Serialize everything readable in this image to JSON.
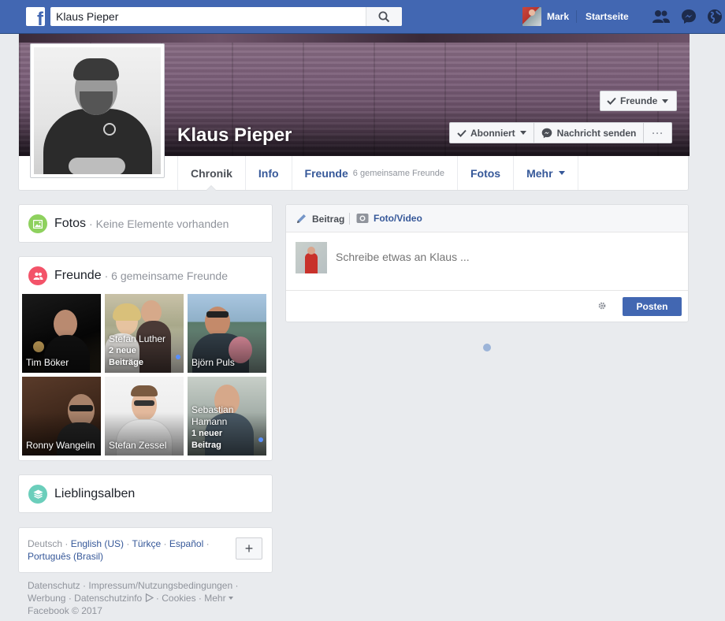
{
  "topbar": {
    "logo_letter": "f",
    "search_value": "Klaus Pieper",
    "user_name": "Mark",
    "home_label": "Startseite",
    "icons": [
      "friend-requests-icon",
      "messenger-icon",
      "notifications-globe-icon"
    ]
  },
  "profile": {
    "name": "Klaus Pieper",
    "friends_button": "Freunde",
    "subscribed_button": "Abonniert",
    "message_button": "Nachricht senden",
    "more_button": "···"
  },
  "tabs": [
    {
      "label": "Chronik",
      "sub": ""
    },
    {
      "label": "Info",
      "sub": ""
    },
    {
      "label": "Freunde",
      "sub": "6 gemeinsame Freunde"
    },
    {
      "label": "Fotos",
      "sub": ""
    },
    {
      "label": "Mehr",
      "sub": ""
    }
  ],
  "photos_card": {
    "title": "Fotos",
    "sub": "· Keine Elemente vorhanden"
  },
  "friends_card": {
    "title": "Freunde",
    "sub": "· 6 gemeinsame Freunde",
    "friends": [
      {
        "name": "Tim Böker",
        "note": ""
      },
      {
        "name": "Stefan Luther",
        "note": "2 neue Beiträge"
      },
      {
        "name": "Björn Puls",
        "note": ""
      },
      {
        "name": "Ronny Wangelin",
        "note": ""
      },
      {
        "name": "Stefan Zessel",
        "note": ""
      },
      {
        "name": "Sebastian Hamann",
        "note": "1 neuer Beitrag"
      }
    ]
  },
  "albums_card": {
    "title": "Lieblingsalben"
  },
  "languages": {
    "current": "Deutsch",
    "links": [
      "English (US)",
      "Türkçe",
      "Español",
      "Português (Brasil)"
    ],
    "plus": "+"
  },
  "footer": {
    "links": [
      "Datenschutz",
      "Impressum/Nutzungsbedingungen",
      "Werbung",
      "Datenschutzinfo",
      "Cookies",
      "Mehr"
    ],
    "copyright": "Facebook © 2017"
  },
  "composer": {
    "tab_post": "Beitrag",
    "tab_photo": "Foto/Video",
    "placeholder": "Schreibe etwas an Klaus ...",
    "post_button": "Posten"
  },
  "colors": {
    "brand": "#4267b2",
    "link": "#365899",
    "photos_icon": "#8ed15e",
    "friends_icon": "#f35369",
    "albums_icon": "#6bcebb"
  }
}
